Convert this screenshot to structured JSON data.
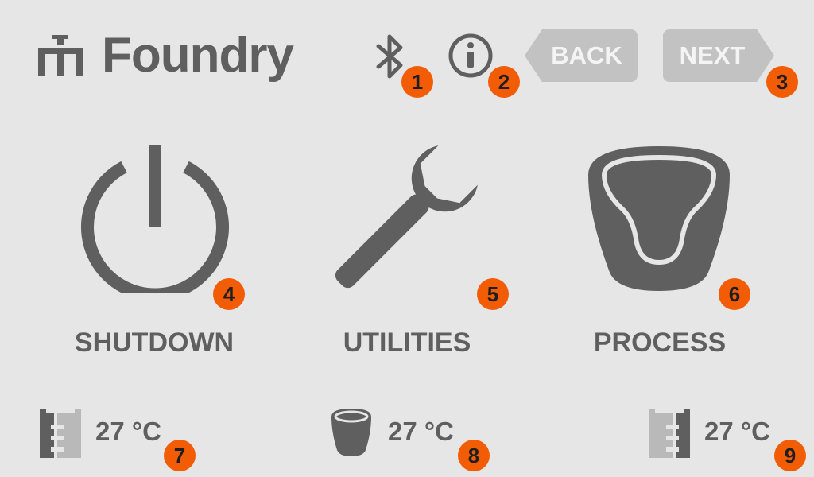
{
  "header": {
    "logo_text": "Foundry",
    "back_label": "BACK",
    "next_label": "NEXT"
  },
  "badges": [
    "1",
    "2",
    "3",
    "4",
    "5",
    "6",
    "7",
    "8",
    "9"
  ],
  "menu": {
    "shutdown_label": "SHUTDOWN",
    "utilities_label": "UTILITIES",
    "process_label": "PROCESS"
  },
  "status": {
    "left_temp": "27 °C",
    "center_temp": "27 °C",
    "right_temp": "27 °C"
  },
  "colors": {
    "background": "#e6e6e6",
    "icon_gray": "#5f5f5f",
    "button_gray": "#c2c2c2",
    "badge_orange": "#f25c05"
  },
  "icons": [
    "foundry-logo-icon",
    "bluetooth-icon",
    "info-icon",
    "power-icon",
    "wrench-icon",
    "crucible-icon",
    "left-heater-icon",
    "crucible-small-icon",
    "right-heater-icon"
  ]
}
